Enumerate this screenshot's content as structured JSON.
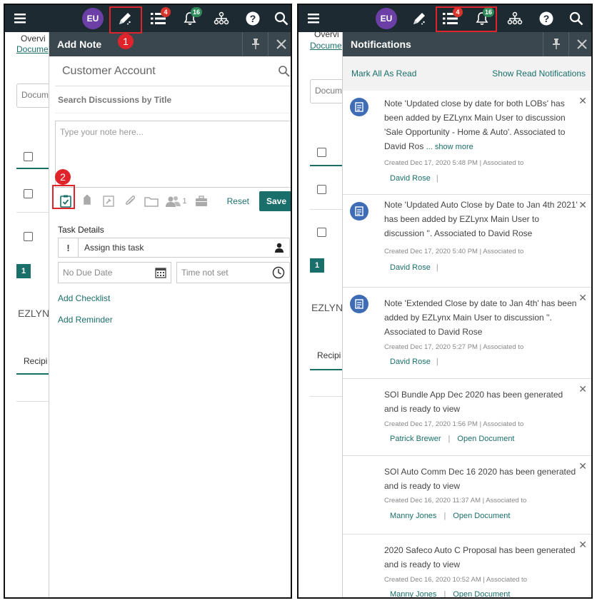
{
  "left": {
    "topbar": {
      "avatar": "EU",
      "tasks_badge": "4",
      "notif_badge": "16",
      "step_label": "1"
    },
    "background": {
      "tab_overview": "Overvi",
      "tab_documents": "Docume",
      "input_text": "Docum",
      "page_number": "1",
      "section_text": "EZLYN",
      "recipients_text": "Recipi"
    },
    "add_note": {
      "title": "Add Note",
      "customer_search": "Customer Account",
      "discussion_search": "Search Discussions by Title",
      "note_placeholder": "Type your note here...",
      "step_label": "2",
      "contacts_count": "1",
      "reset_label": "Reset",
      "save_label": "Save",
      "task_details_label": "Task Details",
      "priority_symbol": "!",
      "assign_value": "Assign this task",
      "due_date_placeholder": "No Due Date",
      "time_placeholder": "Time not set",
      "add_checklist": "Add Checklist",
      "add_reminder": "Add Reminder"
    }
  },
  "right": {
    "topbar": {
      "avatar": "EU",
      "tasks_badge": "4",
      "notif_badge": "16"
    },
    "background": {
      "tab_overview": "Overvi",
      "tab_documents": "Docume",
      "input_text": "Docum",
      "page_number": "1",
      "section_text": "EZLYN",
      "recipients_text": "Recipi"
    },
    "notifications": {
      "title": "Notifications",
      "mark_all_read": "Mark All As Read",
      "show_read": "Show Read Notifications",
      "items": [
        {
          "message": "Note 'Updated close by date for both LOBs' has been added by EZLynx Main User to discussion 'Sale Opportunity - Home & Auto'. Associated to David Ros",
          "show_more": "... show more",
          "meta": "Created Dec 17, 2020 5:48 PM | Associated to",
          "link1": "David Rose",
          "sep": "|",
          "link2": ""
        },
        {
          "message": "Note 'Updated Auto Close by Date to Jan 4th 2021' has been added by EZLynx Main User to discussion ''. Associated to David Rose",
          "meta": "Created Dec 17, 2020 5:40 PM | Associated to",
          "link1": "David Rose",
          "sep": "|",
          "link2": ""
        },
        {
          "message": "Note 'Extended Close by date to Jan 4th' has been added by EZLynx Main User to discussion ''. Associated to David Rose",
          "meta": "Created Dec 17, 2020 5:27 PM | Associated to",
          "link1": "David Rose",
          "sep": "|",
          "link2": ""
        },
        {
          "message": "SOI Bundle App Dec 2020 has been generated and is ready to view",
          "meta": "Created Dec 17, 2020 1:56 PM | Associated to",
          "link1": "Patrick Brewer",
          "sep": "|",
          "link2": "Open Document"
        },
        {
          "message": "SOI Auto Comm Dec 16 2020 has been generated and is ready to view",
          "meta": "Created Dec 16, 2020 11:37 AM | Associated to",
          "link1": "Manny Jones",
          "sep": "|",
          "link2": "Open Document"
        },
        {
          "message": "2020 Safeco Auto C Proposal has been generated and is ready to view",
          "meta": "Created Dec 16, 2020 10:52 AM | Associated to",
          "link1": "Manny Jones",
          "sep": "|",
          "link2": "Open Document"
        }
      ]
    }
  },
  "colors": {
    "topbar": "#1e2a32",
    "drawer_header": "#3a474e",
    "accent": "#1a6f6a",
    "avatar": "#6b3fa6",
    "badge_red": "#d9342b",
    "badge_green": "#2f8a5a",
    "highlight": "#e0242b",
    "doc_icon": "#3e6db5"
  }
}
